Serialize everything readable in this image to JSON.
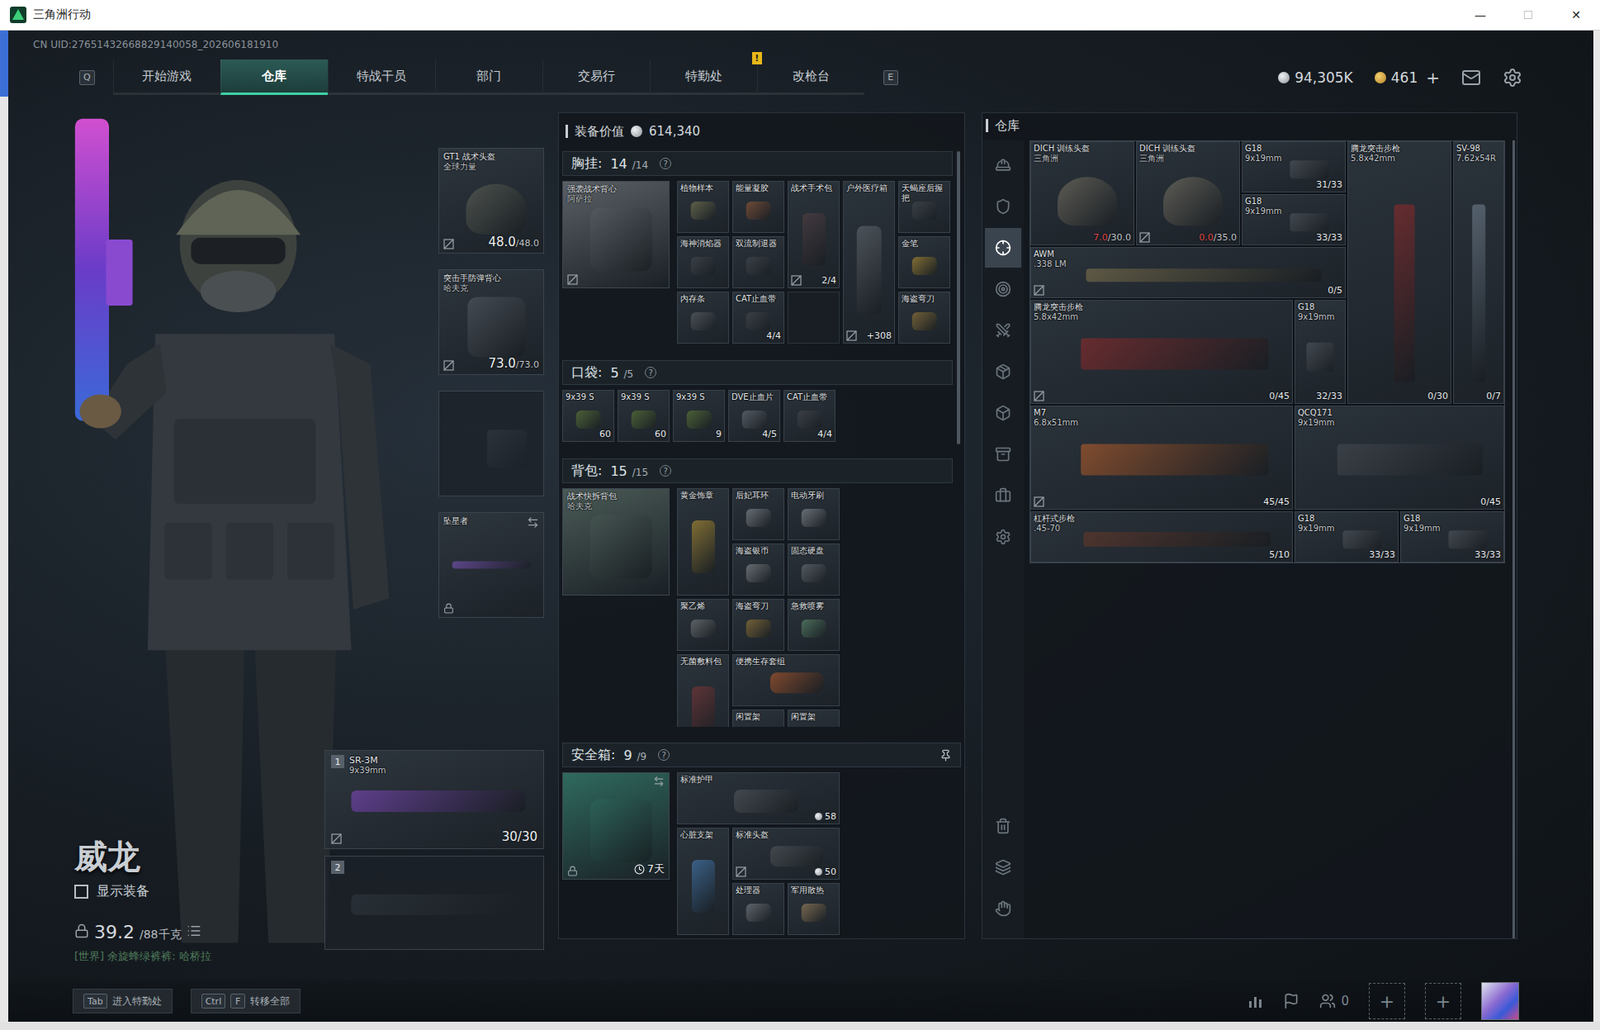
{
  "window": {
    "title": "三角洲行动",
    "controls": [
      {
        "glyph": "—",
        "disabled": false
      },
      {
        "glyph": "☐",
        "disabled": true
      },
      {
        "glyph": "✕",
        "disabled": false
      }
    ]
  },
  "uid": "CN UID:27651432668829140058_202606181910",
  "nav": {
    "prev_key": "Q",
    "next_key": "E",
    "tabs": [
      {
        "label": "开始游戏",
        "selected": false,
        "badge": ""
      },
      {
        "label": "仓库",
        "selected": true,
        "badge": ""
      },
      {
        "label": "特战干员",
        "selected": false,
        "badge": ""
      },
      {
        "label": "部门",
        "selected": false,
        "badge": ""
      },
      {
        "label": "交易行",
        "selected": false,
        "badge": ""
      },
      {
        "label": "特勤处",
        "selected": false,
        "badge": "!"
      },
      {
        "label": "改枪台",
        "selected": false,
        "badge": ""
      }
    ]
  },
  "currency": [
    {
      "kind": "silver",
      "amount": "94,305K",
      "add": ""
    },
    {
      "kind": "gold",
      "amount": "461",
      "add": "+"
    }
  ],
  "operator": {
    "name": "威龙",
    "show_gear": {
      "label": "显示装备",
      "checked": false
    },
    "weight": {
      "current": "39.2",
      "max": "/88千克"
    },
    "chat": "[世界] 余旋蜂绿裤裤: 哈桥拉"
  },
  "gear": [
    {
      "kind": "helmet",
      "empty": false,
      "name": "GT1 战术头盔",
      "sub": "全球力量",
      "current": "48.0",
      "max": "/48.0",
      "low": false,
      "marked": true,
      "color": "#6a6e60"
    },
    {
      "kind": "armor",
      "empty": false,
      "name": "突击手防弹背心",
      "sub": "哈夫克",
      "current": "73.0",
      "max": "/73.0",
      "low": false,
      "marked": true,
      "color": "#5a6068"
    },
    {
      "kind": "pistol",
      "empty": true
    },
    {
      "kind": "melee",
      "empty": false,
      "name": "坠星者",
      "locked": true,
      "swap": true,
      "marked": false,
      "color": "#8a5ad0"
    }
  ],
  "weapons": [
    {
      "slot": "1",
      "empty": false,
      "name": "SR-3M",
      "sub": "9x39mm",
      "value": "30/30",
      "marked": true,
      "color": "#8a4ad0"
    },
    {
      "slot": "2",
      "empty": true
    }
  ],
  "loadout": {
    "value_label": "装备价值",
    "value": "614,340",
    "sections": [
      {
        "kind": "rig",
        "title": "胸挂:",
        "count": "14",
        "capacity": "/14",
        "help": "?",
        "container": {
          "name": "强袭战术背心",
          "sub": "阿萨拉",
          "marked": true,
          "color": "#5a6066"
        },
        "items": [
          {
            "name": "植物样本",
            "kind": "small",
            "marked": false,
            "color": "#8c8a5a"
          },
          {
            "name": "能量凝胶",
            "kind": "small",
            "marked": false,
            "color": "#a8623a"
          },
          {
            "name": "战术手术包",
            "kind": "tall",
            "value": "2/4",
            "marked": true,
            "color": "#5a4448"
          },
          {
            "name": "户外医疗箱",
            "kind": "tall3",
            "value": "+308",
            "marked": true,
            "color": "#6a7076"
          },
          {
            "name": "天蝎座后握把",
            "kind": "small",
            "marked": false,
            "color": "#4a5056"
          },
          {
            "name": "海神消焰器",
            "kind": "small",
            "marked": false,
            "color": "#4a4f55"
          },
          {
            "name": "双流制退器",
            "kind": "small",
            "marked": false,
            "color": "#4a4f55"
          },
          {
            "name": "金笔",
            "kind": "small",
            "marked": false,
            "color": "#c9a232"
          },
          {
            "name": "内存条",
            "kind": "small",
            "marked": false,
            "color": "#6a6e74"
          },
          {
            "name": "CAT止血带",
            "kind": "small",
            "value": "4/4",
            "marked": false,
            "color": "#4a4e54"
          },
          {
            "kind": "empty"
          },
          {
            "name": "海盗弯刀",
            "kind": "small",
            "marked": false,
            "color": "#b08a3a"
          }
        ]
      },
      {
        "kind": "pockets",
        "title": "口袋:",
        "count": "5",
        "capacity": "/5",
        "help": "?",
        "items": [
          {
            "name": "9x39 S",
            "kind": "small",
            "value": "60",
            "marked": false,
            "color": "#6a8a3a"
          },
          {
            "name": "9x39 S",
            "kind": "small",
            "value": "60",
            "marked": false,
            "color": "#6a8a3a"
          },
          {
            "name": "9x39 S",
            "kind": "small",
            "value": "9",
            "marked": false,
            "color": "#6a8a3a"
          },
          {
            "name": "DVE止血片",
            "kind": "small",
            "value": "4/5",
            "marked": false,
            "color": "#7a8088"
          },
          {
            "name": "CAT止血带",
            "kind": "small",
            "value": "4/4",
            "marked": false,
            "color": "#4a4e54"
          }
        ]
      },
      {
        "kind": "backpack",
        "title": "背包:",
        "count": "15",
        "capacity": "/15",
        "help": "?",
        "container": {
          "name": "战术快拆背包",
          "sub": "哈夫克",
          "marked": false,
          "color": "#4a5a56"
        },
        "items": [
          {
            "name": "黄金饰章",
            "kind": "tall",
            "marked": false,
            "color": "#c9a232"
          },
          {
            "name": "后妃耳环",
            "kind": "small",
            "marked": false,
            "color": "#9aa0a6"
          },
          {
            "name": "电动牙刷",
            "kind": "small",
            "marked": false,
            "color": "#a0a6ac"
          },
          {
            "name": "海盗银币",
            "kind": "small",
            "marked": false,
            "color": "#9ca0a4"
          },
          {
            "name": "固态硬盘",
            "kind": "small",
            "marked": false,
            "color": "#7a8086"
          },
          {
            "name": "聚乙烯",
            "kind": "small",
            "marked": false,
            "color": "#8a8e90"
          },
          {
            "name": "海盗弯刀",
            "kind": "small",
            "marked": false,
            "color": "#b08a3a"
          },
          {
            "name": "急救喷雾",
            "kind": "small",
            "marked": false,
            "color": "#6aa07a"
          },
          {
            "name": "无菌敷料包",
            "kind": "tall",
            "marked": false,
            "color": "#8a3a3a"
          },
          {
            "name": "便携生存套组",
            "kind": "wide",
            "marked": false,
            "color": "#c8602a"
          },
          {
            "name": "闲置架",
            "kind": "small",
            "marked": false,
            "color": "#5a6066"
          },
          {
            "name": "闲置架",
            "kind": "small",
            "marked": false,
            "color": "#5a6066"
          }
        ]
      }
    ],
    "safe": {
      "kind": "safe",
      "title": "安全箱:",
      "count": "9",
      "capacity": "/9",
      "help": "?",
      "pinned": true,
      "container": {
        "time": "7天",
        "locked": true,
        "swap": true,
        "marked": false,
        "color": "#2f6a5e"
      },
      "items": [
        {
          "name": "标准护甲",
          "kind": "wide3",
          "value": "58",
          "priced": true,
          "marked": false,
          "color": "#5a5e62"
        },
        {
          "name": "心脏支架",
          "kind": "tall",
          "marked": false,
          "color": "#4a8ac8"
        },
        {
          "name": "标准头盔",
          "kind": "wide",
          "value": "50",
          "priced": true,
          "marked": true,
          "color": "#5a5e62"
        },
        {
          "name": "处理器",
          "kind": "small",
          "marked": false,
          "color": "#8a9096"
        },
        {
          "name": "军用散热",
          "kind": "small",
          "marked": false,
          "color": "#b8986a"
        }
      ]
    }
  },
  "stash": {
    "title": "仓库",
    "tabs": [
      {
        "selected": false
      },
      {
        "selected": false
      },
      {
        "selected": true
      },
      {
        "selected": false
      },
      {
        "selected": false
      },
      {
        "selected": false
      },
      {
        "selected": false
      },
      {
        "selected": false
      },
      {
        "selected": false
      },
      {
        "selected": false
      }
    ],
    "items": [
      {
        "kind": "helmet",
        "name": "DICH 训练头盔",
        "sub": "三角洲",
        "current": "7.0",
        "max": "/30.0",
        "low": true,
        "marked": false,
        "color": "#8a8270"
      },
      {
        "kind": "helmet",
        "name": "DICH 训练头盔",
        "sub": "三角洲",
        "current": "0.0",
        "max": "/35.0",
        "low": true,
        "marked": true,
        "color": "#8a8270"
      },
      {
        "kind": "pistol",
        "name": "G18",
        "sub": "9x19mm",
        "value": "31/33",
        "marked": false,
        "color": "#5a5f66"
      },
      {
        "kind": "rifle-v",
        "name": "腾龙突击步枪",
        "sub": "5.8x42mm",
        "value": "0/30",
        "marked": false,
        "color": "#9b2a2a"
      },
      {
        "kind": "dmr-v",
        "name": "SV-98",
        "sub": "7.62x54R",
        "value": "0/7",
        "marked": false,
        "color": "#7a8a9a"
      },
      {
        "kind": "pistol",
        "name": "G18",
        "sub": "9x19mm",
        "value": "33/33",
        "marked": false,
        "color": "#5a5f66"
      },
      {
        "kind": "sniper",
        "name": "AWM",
        "sub": ".338 LM",
        "value": "0/5",
        "marked": true,
        "color": "#8a7a50"
      },
      {
        "kind": "rifle",
        "name": "腾龙突击步枪",
        "sub": "5.8x42mm",
        "value": "0/45",
        "marked": true,
        "color": "#9b2a2a"
      },
      {
        "kind": "pistol-v",
        "name": "G18",
        "sub": "9x19mm",
        "value": "32/33",
        "marked": false,
        "color": "#5a5f66"
      },
      {
        "kind": "rifle",
        "name": "M7",
        "sub": "6.8x51mm",
        "value": "45/45",
        "marked": true,
        "color": "#c8642a"
      },
      {
        "kind": "smg",
        "name": "QCQ171",
        "sub": "9x19mm",
        "value": "0/45",
        "marked": false,
        "color": "#4a4e55"
      },
      {
        "kind": "lever",
        "name": "杠杆式步枪",
        "sub": ".45-70",
        "value": "5/10",
        "marked": false,
        "color": "#6e3a28"
      },
      {
        "kind": "pistol",
        "name": "G18",
        "sub": "9x19mm",
        "value": "33/33",
        "marked": false,
        "color": "#5a5f66"
      },
      {
        "kind": "pistol",
        "name": "G18",
        "sub": "9x19mm",
        "value": "33/33",
        "marked": false,
        "color": "#5a5f66"
      }
    ]
  },
  "hints": [
    {
      "keys": [
        "Tab"
      ],
      "label": "进入特勤处"
    },
    {
      "keys": [
        "Ctrl",
        "F"
      ],
      "label": "转移全部"
    }
  ],
  "social": {
    "friends": "0",
    "add_slots": [
      "+",
      "+"
    ]
  }
}
